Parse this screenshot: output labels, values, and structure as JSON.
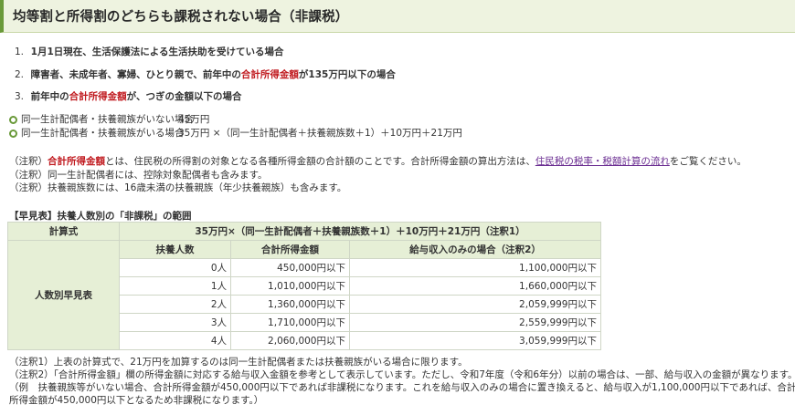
{
  "title": "均等割と所得割のどちらも課税されない場合（非課税）",
  "conditions": [
    {
      "num": "1.",
      "before": "1月1日現在、生活保護法による生活扶助を受けている場合",
      "red": "",
      "after": ""
    },
    {
      "num": "2.",
      "before": "障害者、未成年者、寡婦、ひとり親で、前年中の",
      "red": "合計所得金額",
      "after": "が135万円以下の場合"
    },
    {
      "num": "3.",
      "before": "前年中の",
      "red": "合計所得金額",
      "after": "が、つぎの金額以下の場合"
    }
  ],
  "thresholds": [
    {
      "label": "同一生計配偶者・扶養親族がいない場合",
      "value": "45万円"
    },
    {
      "label": "同一生計配偶者・扶養親族がいる場合",
      "value": "35万円 ×（同一生計配偶者＋扶養親族数＋1）＋10万円＋21万円"
    }
  ],
  "notes": {
    "n1_prefix": "（注釈）",
    "n1_term": "合計所得金額",
    "n1_body": "とは、住民税の所得割の対象となる各種所得金額の合計額のことです。合計所得金額の算出方法は、",
    "n1_link": "住民税の税率・税額計算の流れ",
    "n1_suffix": "をご覧ください。",
    "n2": "（注釈）同一生計配偶者には、控除対象配偶者も含みます。",
    "n3": "（注釈）扶養親族数には、16歳未満の扶養親族（年少扶養親族）も含みます。"
  },
  "table": {
    "caption": "【早見表】扶養人数別の「非課税」の範囲",
    "formula_label": "計算式",
    "formula": "35万円×（同一生計配偶者＋扶養親族数＋1）＋10万円＋21万円（注釈1）",
    "side_label": "人数別早見表",
    "headers": [
      "扶養人数",
      "合計所得金額",
      "給与収入のみの場合（注釈2）"
    ],
    "rows": [
      [
        "0人",
        "450,000円以下",
        "1,100,000円以下"
      ],
      [
        "1人",
        "1,010,000円以下",
        "1,660,000円以下"
      ],
      [
        "2人",
        "1,360,000円以下",
        "2,059,999円以下"
      ],
      [
        "3人",
        "1,710,000円以下",
        "2,559,999円以下"
      ],
      [
        "4人",
        "2,060,000円以下",
        "3,059,999円以下"
      ]
    ]
  },
  "footnotes": [
    "（注釈1）上表の計算式で、21万円を加算するのは同一生計配偶者または扶養親族がいる場合に限ります。",
    "（注釈2）「合計所得金額」欄の所得金額に対応する給与収入金額を参考として表示しています。ただし、令和7年度（令和6年分）以前の場合は、一部、給与収入の金額が異なります。",
    "（例　扶養親族等がいない場合、合計所得金額が450,000円以下であれば非課税になります。これを給与収入のみの場合に置き換えると、給与収入が1,100,000円以下であれば、合計",
    "所得金額が450,000円以下となるため非課税になります。）"
  ],
  "colors": {
    "accent": "#6a9a3a",
    "red": "#c0191e",
    "link": "#6a2c91",
    "header_bg": "#e6efd6",
    "title_bg": "#eef3e0"
  }
}
